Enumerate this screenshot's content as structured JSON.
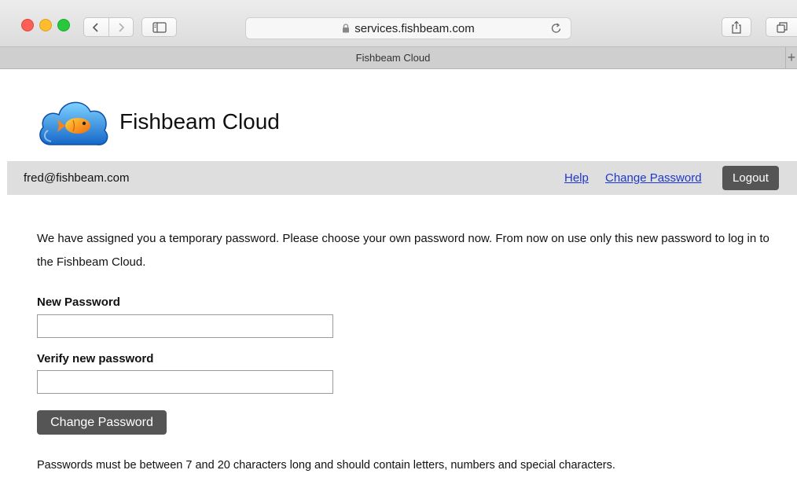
{
  "browser": {
    "url": "services.fishbeam.com",
    "tab_title": "Fishbeam Cloud",
    "new_tab_glyph": "+",
    "icons": [
      "lock-icon",
      "reload-icon",
      "back-icon",
      "forward-icon",
      "sidebar-icon",
      "share-icon",
      "tabs-icon"
    ]
  },
  "header": {
    "brand": "Fishbeam Cloud",
    "logo_icon": "fish-cloud-logo"
  },
  "userbar": {
    "email": "fred@fishbeam.com",
    "help_label": "Help",
    "change_password_label": "Change Password",
    "logout_label": "Logout"
  },
  "form": {
    "intro": "We have assigned you a temporary password. Please choose your own password now. From now on use only this new password to log in to the Fishbeam Cloud.",
    "new_password_label": "New Password",
    "new_password_value": "",
    "verify_password_label": "Verify new password",
    "verify_password_value": "",
    "submit_label": "Change Password",
    "note": "Passwords must be between 7 and 20 characters long and should contain letters, numbers and special characters."
  },
  "colors": {
    "link": "#1f38cc",
    "button_bg": "#555555",
    "userbar_bg": "#dedede"
  }
}
